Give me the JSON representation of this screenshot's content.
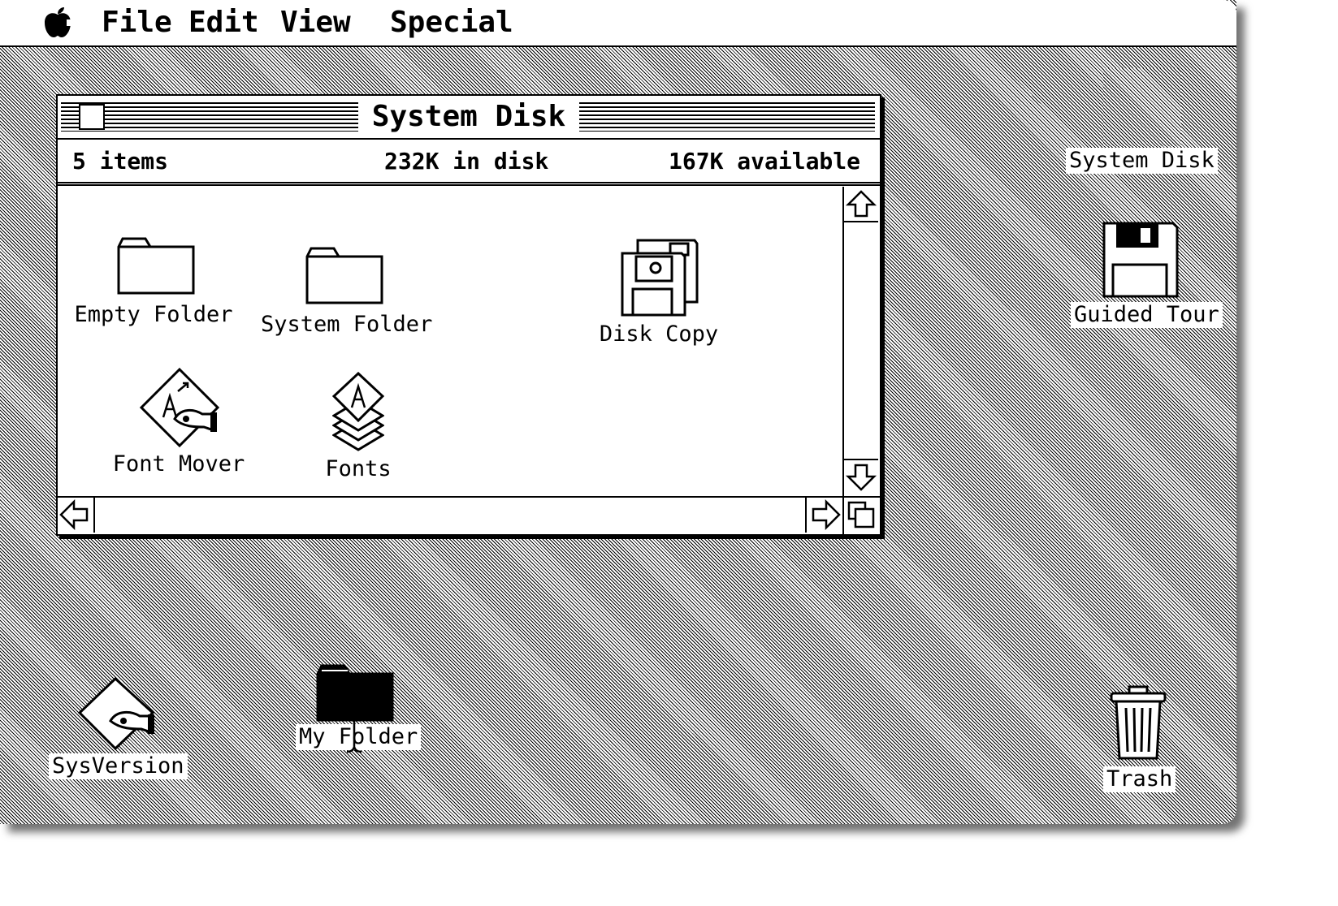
{
  "menubar": {
    "apple_icon": "apple-icon",
    "items": [
      {
        "label": "File"
      },
      {
        "label": "Edit"
      },
      {
        "label": "View"
      },
      {
        "label": "Special"
      }
    ]
  },
  "window": {
    "title": "System Disk",
    "info": {
      "items": "5 items",
      "in_disk": "232K in disk",
      "available": "167K available"
    },
    "icons": [
      {
        "label": "Empty Folder",
        "icon": "folder-icon"
      },
      {
        "label": "System Folder",
        "icon": "folder-icon"
      },
      {
        "label": "Disk Copy",
        "icon": "disk-copy-icon"
      },
      {
        "label": "Font Mover",
        "icon": "font-mover-icon"
      },
      {
        "label": "Fonts",
        "icon": "fonts-icon"
      }
    ]
  },
  "desktop": {
    "icons": [
      {
        "label": "System Disk",
        "icon": "disk-icon"
      },
      {
        "label": "Guided Tour",
        "icon": "floppy-disk-icon"
      },
      {
        "label": "SysVersion",
        "icon": "sysversion-icon"
      },
      {
        "label": "My Folder",
        "icon": "folder-icon"
      },
      {
        "label": "Trash",
        "icon": "trash-icon"
      }
    ]
  }
}
